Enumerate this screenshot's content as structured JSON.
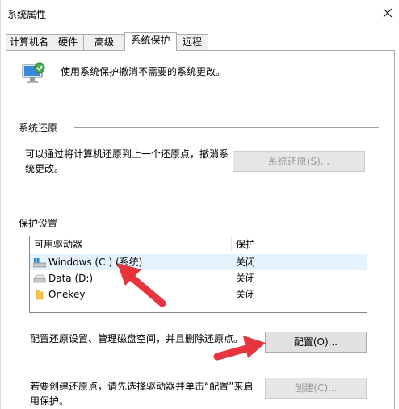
{
  "window": {
    "title": "系统属性"
  },
  "tabs": [
    {
      "label": "计算机名"
    },
    {
      "label": "硬件"
    },
    {
      "label": "高级"
    },
    {
      "label": "系统保护"
    },
    {
      "label": "远程"
    }
  ],
  "intro": {
    "text": "使用系统保护撤消不需要的系统更改。"
  },
  "restore": {
    "section_title": "系统还原",
    "desc_line1": "可以通过将计算机还原到上一个还原点，撤消系",
    "desc_line2": "统更改。",
    "button": "系统还原(S)..."
  },
  "protection": {
    "section_title": "保护设置",
    "columns": [
      "可用驱动器",
      "保护"
    ],
    "drives": [
      {
        "name": "Windows (C:) (系统)",
        "status": "关闭",
        "icon": "system-drive-icon"
      },
      {
        "name": "Data (D:)",
        "status": "关闭",
        "icon": "hard-drive-icon"
      },
      {
        "name": "Onekey",
        "status": "关闭",
        "icon": "folder-icon"
      }
    ],
    "configure_desc": "配置还原设置、管理磁盘空间，并且删除还原点。",
    "configure_button": "配置(O)...",
    "create_desc_line1": "若要创建还原点，请先选择驱动器并单击“配置”来启",
    "create_desc_line2": "用保护。",
    "create_button": "创建(C)..."
  },
  "colors": {
    "annotation_arrow": "#e8343f",
    "selected_row": "#e5f3ff"
  }
}
